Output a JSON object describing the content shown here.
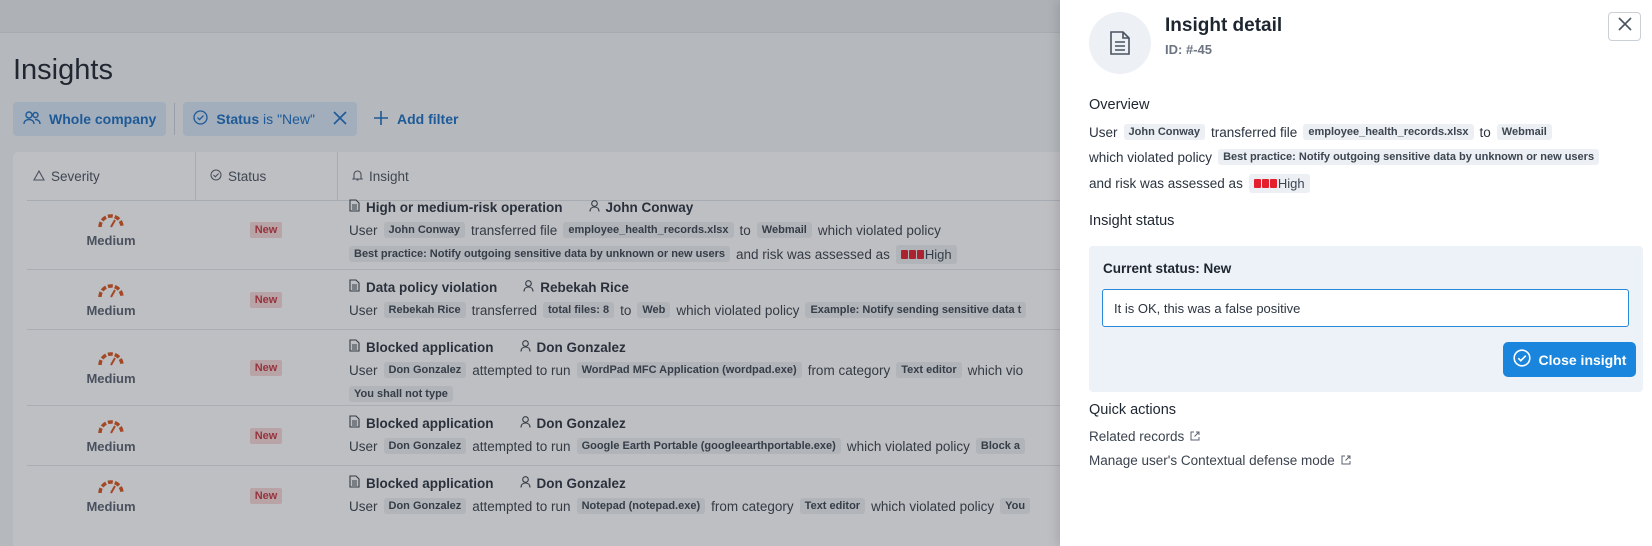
{
  "page": {
    "title": "Insights",
    "filters": {
      "scope_label": "Whole company",
      "status_field": "Status",
      "status_op": "is",
      "status_value": "\"New\"",
      "add_filter_label": "Add filter"
    },
    "table": {
      "columns": [
        "Severity",
        "Status",
        "Insight"
      ],
      "rows": [
        {
          "severity": "Medium",
          "status": "New",
          "title": "High or medium-risk operation",
          "user": "John Conway",
          "line1": {
            "p1": "User",
            "t1": "John Conway",
            "p2": "transferred file",
            "t2": "employee_health_records.xlsx",
            "p3": "to",
            "t3": "Webmail",
            "p4": "which violated policy"
          },
          "line2": {
            "t1": "Best practice: Notify outgoing sensitive data by unknown or new users",
            "p1": "and risk was assessed as",
            "risk": "High"
          }
        },
        {
          "severity": "Medium",
          "status": "New",
          "title": "Data policy violation",
          "user": "Rebekah Rice",
          "line1": {
            "p1": "User",
            "t1": "Rebekah Rice",
            "p2": "transferred",
            "t2": "total files: 8",
            "p3": "to",
            "t3": "Web",
            "p4": "which violated policy",
            "t4": "Example: Notify sending sensitive data t"
          }
        },
        {
          "severity": "Medium",
          "status": "New",
          "title": "Blocked application",
          "user": "Don Gonzalez",
          "line1": {
            "p1": "User",
            "t1": "Don Gonzalez",
            "p2": "attempted to run",
            "t2": "WordPad MFC Application (wordpad.exe)",
            "p3": "from category",
            "t3": "Text editor",
            "p4": "which vio"
          },
          "line2": {
            "t1": "You shall not type"
          }
        },
        {
          "severity": "Medium",
          "status": "New",
          "title": "Blocked application",
          "user": "Don Gonzalez",
          "line1": {
            "p1": "User",
            "t1": "Don Gonzalez",
            "p2": "attempted to run",
            "t2": "Google Earth Portable (googleearthportable.exe)",
            "p3": "which violated policy",
            "t3": "Block a"
          }
        },
        {
          "severity": "Medium",
          "status": "New",
          "title": "Blocked application",
          "user": "Don Gonzalez",
          "line1": {
            "p1": "User",
            "t1": "Don Gonzalez",
            "p2": "attempted to run",
            "t2": "Notepad (notepad.exe)",
            "p3": "from category",
            "t3": "Text editor",
            "p4": "which violated policy",
            "t4": "You"
          }
        }
      ]
    }
  },
  "drawer": {
    "title": "Insight detail",
    "id_text": "ID: #-45",
    "overview": {
      "heading": "Overview",
      "l1": {
        "p1": "User",
        "t1": "John Conway",
        "p2": "transferred file",
        "t2": "employee_health_records.xlsx",
        "p3": "to",
        "t3": "Webmail"
      },
      "l2": {
        "p1": "which violated policy",
        "t1": "Best practice: Notify outgoing sensitive data by unknown or new users"
      },
      "l3": {
        "p1": "and risk was assessed as",
        "risk": "High"
      }
    },
    "status": {
      "heading": "Insight status",
      "current_label": "Current status: New",
      "comment_value": "It is OK, this was a false positive",
      "button_label": "Close insight"
    },
    "quick_actions": {
      "heading": "Quick actions",
      "links": [
        "Related records",
        "Manage user's Contextual defense mode"
      ]
    }
  },
  "colors": {
    "accent": "#1985dc",
    "risk_high": "#e5202e",
    "badge_new_bg": "#f7d7d9",
    "badge_new_fg": "#c53942",
    "gauge": "#d9531e"
  }
}
